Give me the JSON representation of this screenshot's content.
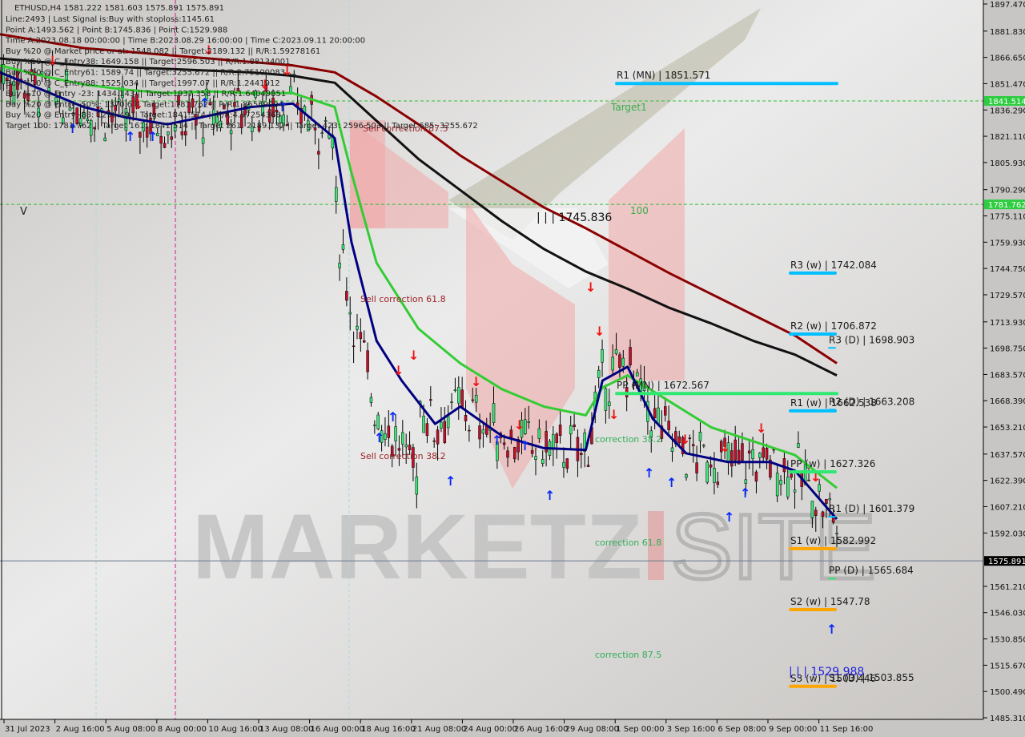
{
  "header": {
    "symbol_line": "ETHUSD,H4  1581.222 1581.603 1575.891 1575.891",
    "info_lines": [
      "Line:2493 | Last Signal is:Buy with stoploss:1145.61",
      "Point A:1493.562 | Point B:1745.836 | Point C:1529.988",
      "Time A:2023.08.18 00:00:00 | Time B:2023.08.29 16:00:00 | Time C:2023.09.11 20:00:00",
      "Buy %20 @ Market price or at: 1548.082 || Target:2189.132 || R/R:1.59278161",
      "Buy %10 @ C_Entry38: 1649.158 || Target:2596.503 || R/R:1.88134001",
      "Buy %10 @ C_Entry61: 1589.74 || Target:3255.672 || R/R:2.75100083",
      "Buy %10 @ C_Entry88: 1525.034 || Target:1997.07 || R/R:1.2441912",
      "Buy %10 @ Entry -23: 1434.143 || Target:1937.358 || R/R:1.64049851",
      "Buy %20 @ Entry -50%: 1370.6 || Target:1781.762 || R/R:1.85569904",
      "Buy %20 @ Entry -88: 1290.49 || Target:1841.514 || R/R:4.57254368",
      "Target 100: 1781.762 || Target 161: 1841.514 || Target 261: 2189.132 || Target 423: 2596.503 || Target 685: 3255.672"
    ]
  },
  "watermark": {
    "left": "MARKETZ",
    "right": "SITE"
  },
  "chart_data": {
    "type": "candlestick",
    "title": "ETHUSD,H4",
    "ohlc_current": {
      "open": 1581.222,
      "high": 1581.603,
      "low": 1575.891,
      "close": 1575.891
    },
    "current_price": 1575.891,
    "ylim": [
      1485.31,
      1897.47
    ],
    "y_ticks": [
      1897.47,
      1881.83,
      1866.65,
      1851.47,
      1836.29,
      1821.11,
      1805.93,
      1790.29,
      1775.11,
      1759.93,
      1744.75,
      1729.57,
      1713.93,
      1698.75,
      1683.57,
      1668.39,
      1653.21,
      1637.57,
      1622.39,
      1607.21,
      1592.03,
      1561.21,
      1546.03,
      1530.85,
      1515.67,
      1500.49,
      1485.31
    ],
    "x_ticks": [
      "31 Jul 2023",
      "2 Aug 16:00",
      "5 Aug 08:00",
      "8 Aug 00:00",
      "10 Aug 16:00",
      "13 Aug 08:00",
      "16 Aug 00:00",
      "18 Aug 16:00",
      "21 Aug 08:00",
      "24 Aug 00:00",
      "26 Aug 16:00",
      "29 Aug 08:00",
      "1 Sep 00:00",
      "3 Sep 16:00",
      "6 Sep 08:00",
      "9 Sep 00:00",
      "11 Sep 16:00"
    ],
    "highlighted_prices": [
      {
        "label": "1841.514",
        "value": 1841.514,
        "color": "#2ecc40"
      },
      {
        "label": "1781.762",
        "value": 1781.762,
        "color": "#2ecc40"
      },
      {
        "label": "1575.891",
        "value": 1575.891,
        "color": "#000000"
      }
    ],
    "target_lines": [
      {
        "label": "Target1",
        "value": 1841.514
      },
      {
        "label": "100",
        "value": 1781.762
      }
    ],
    "pivot_levels": [
      {
        "label": "R1 (MN) | 1851.571",
        "value": 1851.571,
        "color": "#00bfff",
        "span": "wide"
      },
      {
        "label": "R3 (w) | 1742.084",
        "value": 1742.084,
        "color": "#00bfff",
        "span": "short"
      },
      {
        "label": "R2 (w) | 1706.872",
        "value": 1706.872,
        "color": "#00bfff",
        "span": "short"
      },
      {
        "label": "R3 (D) | 1698.903",
        "value": 1698.903,
        "color": "#00bfff",
        "span": "tiny"
      },
      {
        "label": "PP (MN) | 1672.567",
        "value": 1672.567,
        "color": "#2ee872",
        "span": "wide"
      },
      {
        "label": "R1 (w) | 1662.538",
        "value": 1662.538,
        "color": "#00bfff",
        "span": "short"
      },
      {
        "label": "R2 (D) | 1663.208",
        "value": 1663.208,
        "color": "#00bfff",
        "span": "tiny"
      },
      {
        "label": "PP (w) | 1627.326",
        "value": 1627.326,
        "color": "#2ee872",
        "span": "short"
      },
      {
        "label": "R1 (D) | 1601.379",
        "value": 1601.379,
        "color": "#00bfff",
        "span": "tiny"
      },
      {
        "label": "S1 (w) | 1582.992",
        "value": 1582.992,
        "color": "#ffa500",
        "span": "short"
      },
      {
        "label": "PP (D) | 1565.684",
        "value": 1565.684,
        "color": "#2ee872",
        "span": "tiny"
      },
      {
        "label": "S2 (w) | 1547.78",
        "value": 1547.78,
        "color": "#ffa500",
        "span": "short"
      },
      {
        "label": "S3 (w) | 1503.446",
        "value": 1503.446,
        "color": "#ffa500",
        "span": "short"
      },
      {
        "label": "S1 (D) | 1503.855",
        "value": 1503.855,
        "color": "#ffa500",
        "span": "tiny"
      }
    ],
    "wave_points": [
      {
        "label": "| | | 1745.836",
        "value": 1745.836,
        "color": "#111111"
      },
      {
        "label": "| | | 1529.988",
        "value": 1529.988,
        "color": "#2222dd"
      }
    ],
    "correction_labels": [
      {
        "text": "Sell correction 87.5",
        "color": "red"
      },
      {
        "text": "Sell correction 61.8",
        "color": "red"
      },
      {
        "text": "Sell correction 38.2",
        "color": "red"
      },
      {
        "text": "correction 38.2",
        "color": "green"
      },
      {
        "text": "correction 61.8",
        "color": "green"
      },
      {
        "text": "correction 87.5",
        "color": "green"
      }
    ],
    "misc_labels": [
      {
        "text": "V"
      }
    ],
    "series": [
      {
        "name": "MA slow (dark red)",
        "color": "#8b0000",
        "x": [
          0,
          0.05,
          0.1,
          0.15,
          0.2,
          0.25,
          0.3,
          0.35,
          0.4,
          0.45,
          0.5,
          0.55,
          0.6,
          0.65,
          0.7,
          0.75,
          0.8,
          0.85,
          0.9,
          0.95,
          1.0
        ],
        "values": [
          1880,
          1876,
          1872,
          1870,
          1868,
          1866,
          1864,
          1862,
          1858,
          1844,
          1828,
          1810,
          1795,
          1780,
          1768,
          1755,
          1742,
          1730,
          1718,
          1706,
          1690
        ]
      },
      {
        "name": "MA medium (black)",
        "color": "#111111",
        "x": [
          0,
          0.05,
          0.1,
          0.15,
          0.2,
          0.25,
          0.3,
          0.35,
          0.4,
          0.45,
          0.5,
          0.55,
          0.6,
          0.65,
          0.7,
          0.75,
          0.8,
          0.85,
          0.9,
          0.95,
          1.0
        ],
        "values": [
          1866,
          1864,
          1862,
          1861,
          1860,
          1859,
          1858,
          1856,
          1852,
          1830,
          1808,
          1790,
          1772,
          1756,
          1743,
          1733,
          1722,
          1713,
          1703,
          1695,
          1683
        ]
      },
      {
        "name": "MA fast (green)",
        "color": "#33cc33",
        "x": [
          0,
          0.05,
          0.1,
          0.15,
          0.2,
          0.25,
          0.3,
          0.35,
          0.4,
          0.42,
          0.45,
          0.5,
          0.55,
          0.6,
          0.65,
          0.7,
          0.72,
          0.75,
          0.8,
          0.85,
          0.9,
          0.95,
          1.0
        ],
        "values": [
          1862,
          1856,
          1851,
          1848,
          1846,
          1847,
          1846,
          1846,
          1838,
          1800,
          1748,
          1710,
          1690,
          1675,
          1665,
          1660,
          1676,
          1683,
          1668,
          1653,
          1645,
          1637,
          1618
        ]
      },
      {
        "name": "MA signal (navy)",
        "color": "#000080",
        "x": [
          0,
          0.05,
          0.1,
          0.15,
          0.2,
          0.25,
          0.3,
          0.35,
          0.4,
          0.42,
          0.45,
          0.48,
          0.52,
          0.55,
          0.6,
          0.65,
          0.7,
          0.72,
          0.75,
          0.78,
          0.82,
          0.87,
          0.92,
          0.95,
          1.0
        ],
        "values": [
          1858,
          1848,
          1838,
          1832,
          1828,
          1833,
          1838,
          1840,
          1820,
          1760,
          1703,
          1680,
          1655,
          1665,
          1648,
          1641,
          1640,
          1680,
          1688,
          1658,
          1638,
          1633,
          1633,
          1628,
          1600
        ]
      }
    ],
    "candles_summary": "H4 candles from 31 Jul 2023 to 11 Sep 2023; high ~1890 early Aug, sharp drop on 17 Aug to ~1550, spike to 1745.836 on 29 Aug, decline to 1529.988 on 11 Sep"
  }
}
